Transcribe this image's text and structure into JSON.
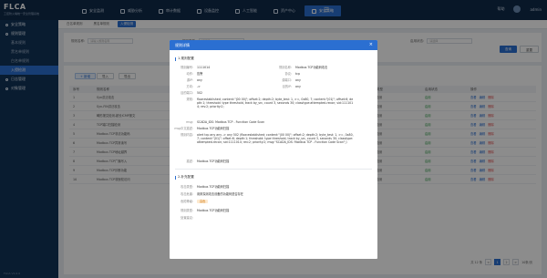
{
  "app": {
    "logo": "FLCA",
    "logo_sub": "工控防火墙统一安全管理系统",
    "nav": [
      {
        "label": "安全监测",
        "active": false
      },
      {
        "label": "威胁分析",
        "active": false
      },
      {
        "label": "审计数据",
        "active": false
      },
      {
        "label": "设备监控",
        "active": false
      },
      {
        "label": "人工智能",
        "active": false
      },
      {
        "label": "资产中心",
        "active": false
      },
      {
        "label": "安全策略",
        "active": true
      }
    ],
    "menu_icon": "☰",
    "user_name": "admin",
    "help_label": "帮助"
  },
  "sidebar": {
    "items": [
      {
        "label": "安全策略",
        "type": "group",
        "active": false
      },
      {
        "label": "规则管理",
        "type": "group",
        "active": false
      },
      {
        "label": "基本规则",
        "type": "sub",
        "active": false
      },
      {
        "label": "黑名单规则",
        "type": "sub",
        "active": false
      },
      {
        "label": "白名单规则",
        "type": "sub",
        "active": false
      },
      {
        "label": "入侵检测",
        "type": "sub",
        "active": true
      },
      {
        "label": "日志管理",
        "type": "group",
        "active": false
      },
      {
        "label": "对象管理",
        "type": "group",
        "active": false
      }
    ],
    "footer": "FLCA V1.0.0"
  },
  "main": {
    "tabs": [
      {
        "label": "白名单规则",
        "active": false
      },
      {
        "label": "黑名单规则",
        "active": false
      },
      {
        "label": "入侵检测",
        "active": true
      }
    ],
    "filters": {
      "name_label": "规则名称:",
      "name_placeholder": "请输入规则名称",
      "type_label": "规则类型:",
      "type_placeholder": "请选择",
      "status_label": "启用状态:",
      "status_placeholder": "请选择",
      "search_label": "查询",
      "reset_label": "重置"
    },
    "toolbar": {
      "add": "+ 新增",
      "import": "导入",
      "export": "导出"
    },
    "table": {
      "headers": [
        "序号",
        "规则名称",
        "规则类型",
        "启用状态",
        "操作"
      ],
      "rows": [
        {
          "no": "1",
          "name": "Syn洪泛攻击",
          "type": "规则检测",
          "status": "启用"
        },
        {
          "no": "2",
          "name": "Syn-FIN洪泛攻击",
          "type": "规则检测",
          "status": "启用"
        },
        {
          "no": "3",
          "name": "畸形报文检测-超长ICMP报文",
          "type": "规则检测",
          "status": "启用"
        },
        {
          "no": "4",
          "name": "TCP端口扫描检测",
          "type": "规则检测",
          "status": "启用"
        },
        {
          "no": "5",
          "name": "Modbus TCP非法功能码",
          "type": "规则检测",
          "status": "启用"
        },
        {
          "no": "6",
          "name": "Modbus TCP异常读写",
          "type": "规则检测",
          "status": "启用"
        },
        {
          "no": "7",
          "name": "Modbus TCP地址越界",
          "type": "规则检测",
          "status": "启用"
        },
        {
          "no": "8",
          "name": "Modbus TCP广播写入",
          "type": "规则检测",
          "status": "启用"
        },
        {
          "no": "9",
          "name": "Modbus TCP诊断功能",
          "type": "规则检测",
          "status": "启用"
        },
        {
          "no": "10",
          "name": "Modbus TCP非授权访问",
          "type": "规则检测",
          "status": "启用"
        }
      ],
      "op_view": "查看",
      "op_edit": "编辑",
      "op_delete": "删除"
    },
    "pager": {
      "total": "共 12 条",
      "pages": [
        "<",
        "1",
        "2",
        ">"
      ],
      "active_index": 1,
      "size": "10条/页"
    }
  },
  "modal": {
    "title": "规则详情",
    "close_icon": "×",
    "basic": {
      "section_title": "1.规则配置",
      "rule_id_label": "规则编号:",
      "rule_id": "1111014",
      "rule_name_label": "规则名称:",
      "rule_name": "Modbus TCP功能码攻击",
      "action_label": "动作:",
      "action": "告警",
      "protocol_label": "协议:",
      "protocol": "tcp",
      "src_ip_label": "源IP:",
      "src_ip": "any",
      "src_port_label": "源端口:",
      "src_port": "any",
      "direction_label": "方向:",
      "direction": "->",
      "dst_ip_label": "目的IP:",
      "dst_ip": "any",
      "dst_port_label": "目的端口:",
      "dst_port": "502",
      "option_label": "规则:",
      "option": "flow:established; content:\"|00 00|\"; offset:2; depth:2; byte_test: 1, >=, 0x80, 7; content:\"|01|\"; offset:6; depth:1; threshold: type threshold, track by_src, count 3, seconds 30; classtype:attempted-recon; sid:1111014; rev:2; priority:2;",
      "msg_label": "msg:",
      "msg": "SCADA_IDS: Modbus TCP - Function Code Scan",
      "msg_cn_label": "msg中文描述:",
      "msg_cn": "Modbus TCP功能码扫描",
      "rule_content_label": "规则内容:",
      "rule_content": "alert tcp any any -> any 502 (flow:established; content:\"|00 00|\"; offset:2; depth:2; byte_test: 1, >=, 0x80, 7; content:\"|01|\"; offset:6; depth:1; threshold: type threshold, track by_src, count 3, seconds 30; classtype:attempted-recon; sid:1111014; rev:2; priority:2; msg:\"SCADA_IDS: Modbus TCP - Function Code Scan\";)",
      "desc_label": "描述:",
      "desc": "Modbus TCP功能码扫描"
    },
    "extra": {
      "section_title": "2.补充配置",
      "attack_type_label": "攻击类型:",
      "attack_type": "Modbus TCP功能码扫描",
      "attack_effect_label": "攻击危害:",
      "attack_effect": "用來探测攻击设备的功能码是否存在",
      "level_label": "危险等级:",
      "level": "高危",
      "rule_type_label": "规则类型:",
      "rule_type": "Modbus TCP功能码扫描",
      "remark_label": "处置建议:",
      "remark": ""
    }
  }
}
